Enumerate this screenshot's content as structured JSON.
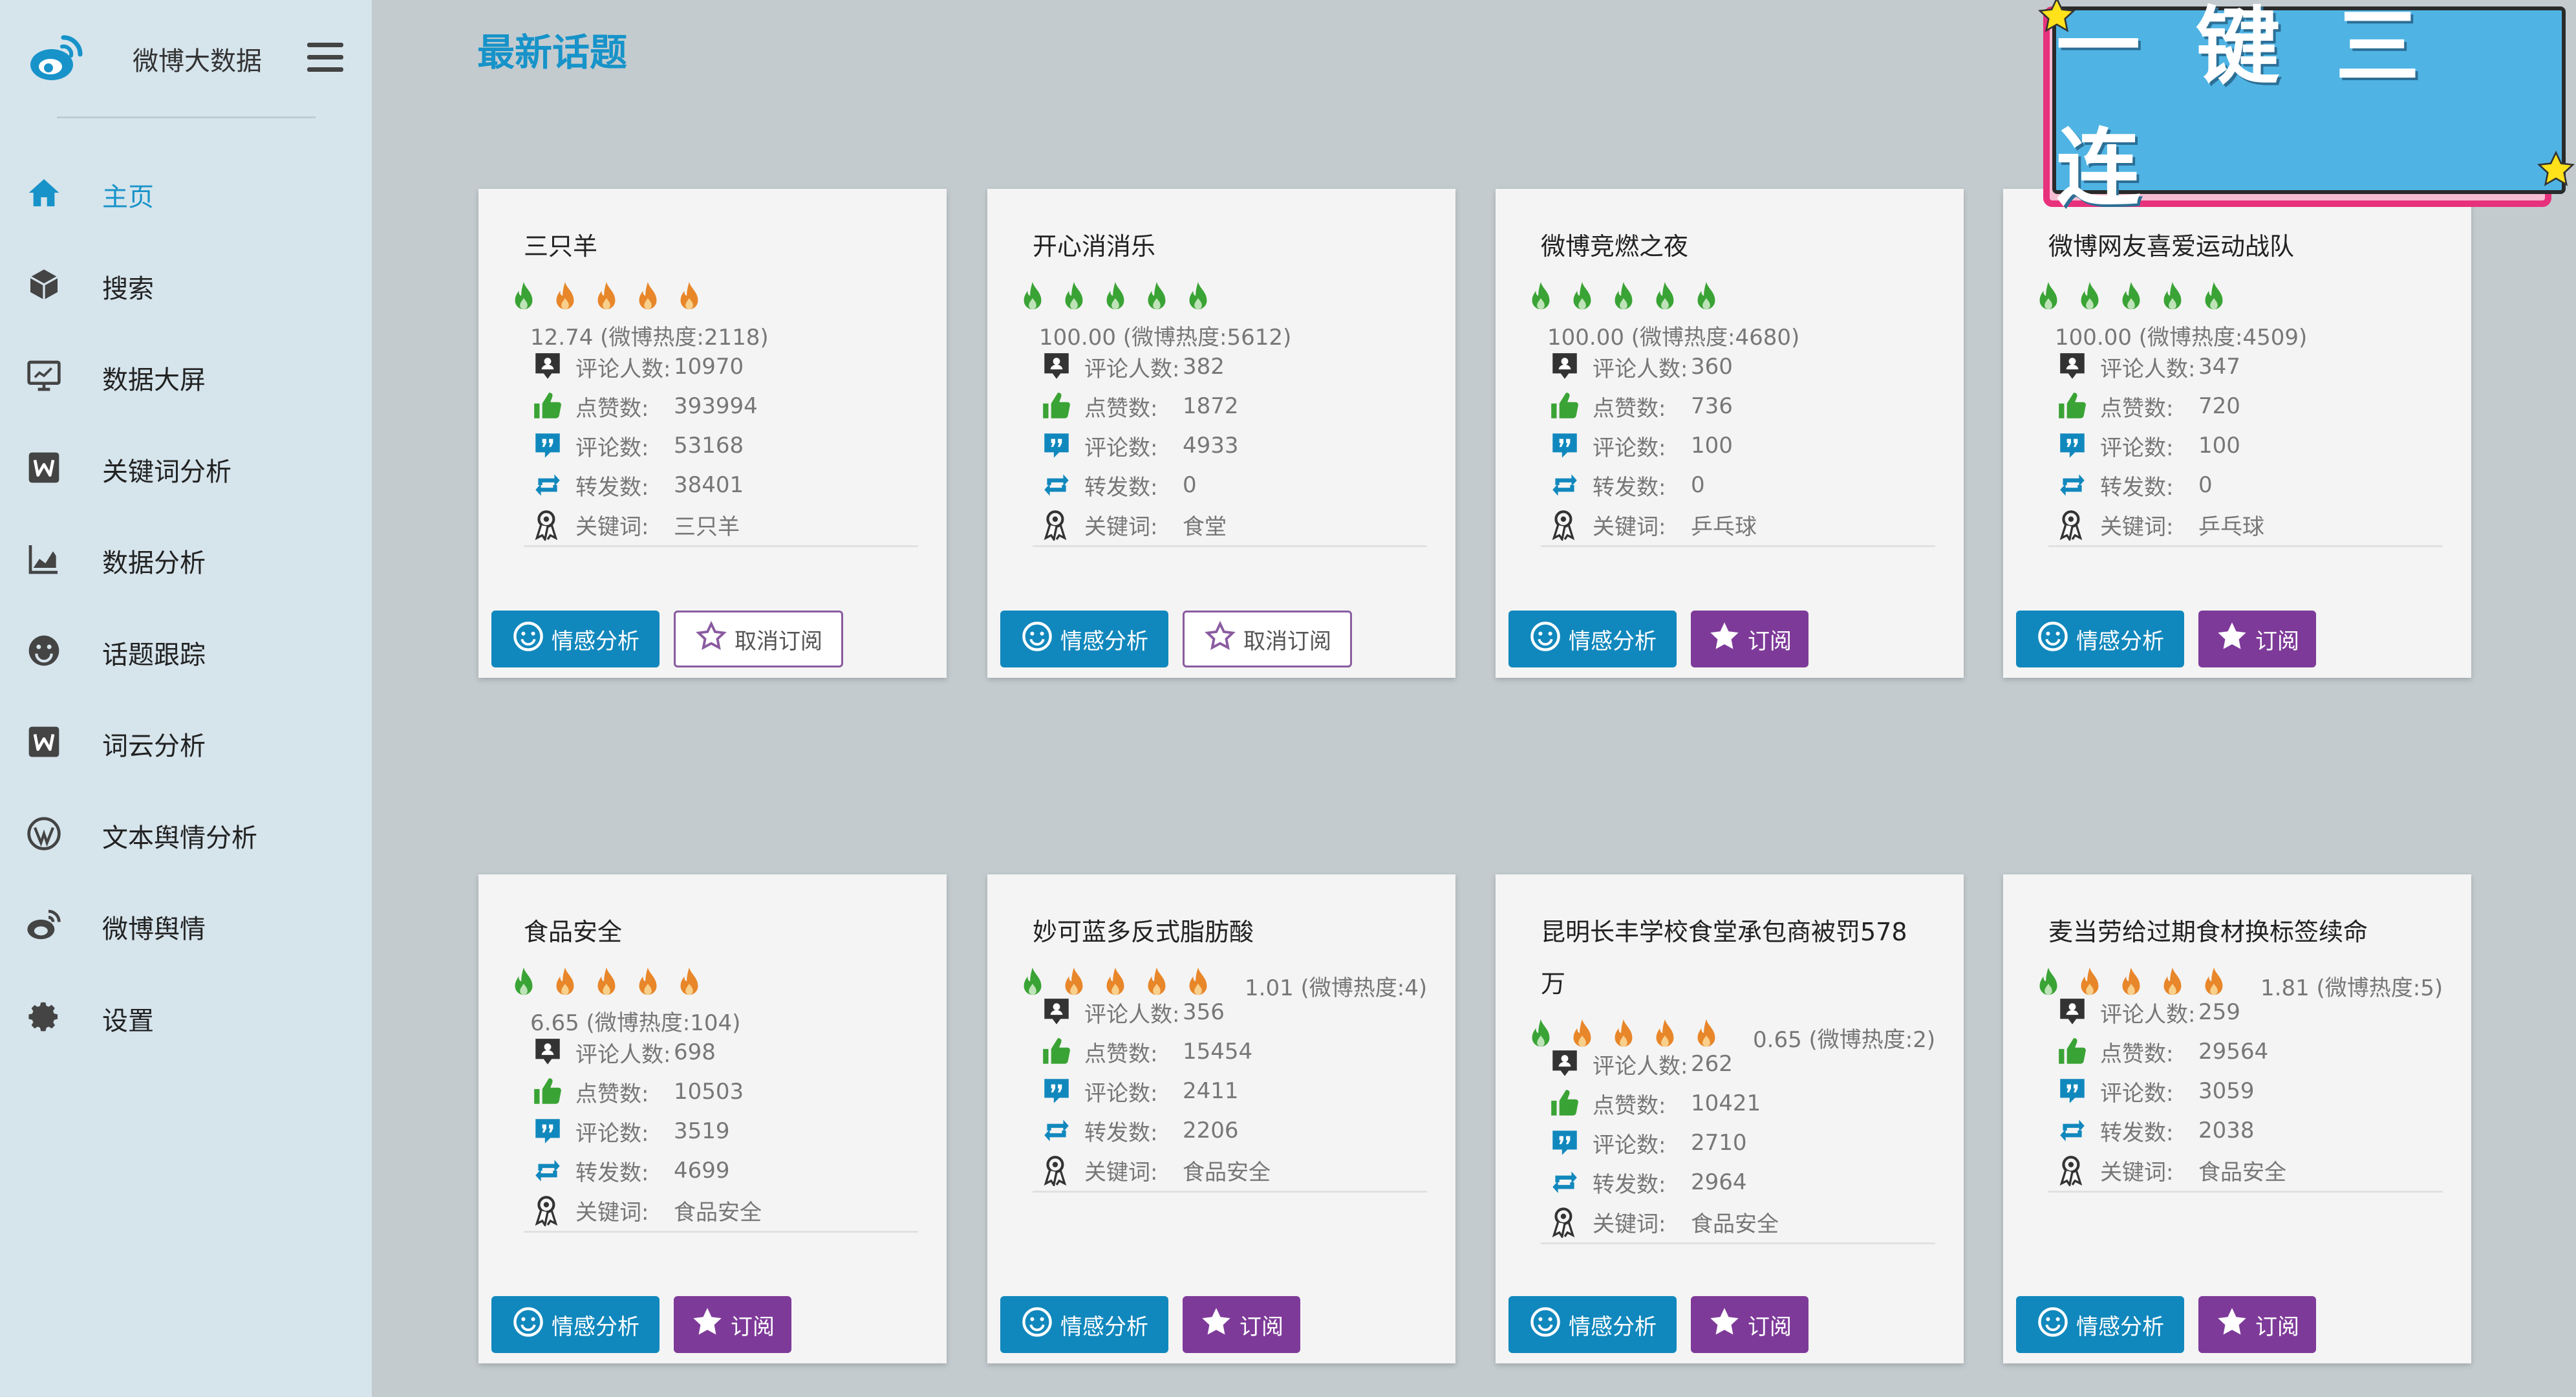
{
  "app": {
    "title": "微博大数据"
  },
  "nav": [
    {
      "label": "主页",
      "icon": "home-icon",
      "active": true
    },
    {
      "label": "搜索",
      "icon": "cube-icon"
    },
    {
      "label": "数据大屏",
      "icon": "monitor-icon"
    },
    {
      "label": "关键词分析",
      "icon": "word-icon"
    },
    {
      "label": "数据分析",
      "icon": "area-chart-icon"
    },
    {
      "label": "话题跟踪",
      "icon": "smile-icon"
    },
    {
      "label": "词云分析",
      "icon": "word-icon"
    },
    {
      "label": "文本舆情分析",
      "icon": "wordpress-icon"
    },
    {
      "label": "微博舆情",
      "icon": "weibo-icon"
    },
    {
      "label": "设置",
      "icon": "gear-icon"
    }
  ],
  "page": {
    "title": "最新话题"
  },
  "labels": {
    "commenters": "评论人数:",
    "likes": "点赞数:",
    "comments": "评论数:",
    "reposts": "转发数:",
    "keyword": "关键词:",
    "emotion_btn": "情感分析",
    "subscribe_btn": "订阅",
    "unsubscribe_btn": "取消订阅"
  },
  "colors": {
    "accent": "#1793c9",
    "button_blue": "#1188bd",
    "button_purple": "#7e3a99",
    "flame_green": "#3aa335",
    "flame_orange": "#e8862a"
  },
  "topics": [
    {
      "title": "三只羊",
      "heat": "12.74 (微博热度:2118)",
      "flame_colors": [
        "g",
        "o",
        "o",
        "o",
        "o"
      ],
      "commenters": "10970",
      "likes": "393994",
      "comments": "53168",
      "reposts": "38401",
      "keyword": "三只羊",
      "subscribed": true
    },
    {
      "title": "开心消消乐",
      "heat": "100.00 (微博热度:5612)",
      "flame_colors": [
        "g",
        "g",
        "g",
        "g",
        "g"
      ],
      "commenters": "382",
      "likes": "1872",
      "comments": "4933",
      "reposts": "0",
      "keyword": "食堂",
      "subscribed": true
    },
    {
      "title": "微博竞燃之夜",
      "heat": "100.00 (微博热度:4680)",
      "flame_colors": [
        "g",
        "g",
        "g",
        "g",
        "g"
      ],
      "commenters": "360",
      "likes": "736",
      "comments": "100",
      "reposts": "0",
      "keyword": "乒乓球",
      "subscribed": false
    },
    {
      "title": "微博网友喜爱运动战队",
      "heat": "100.00 (微博热度:4509)",
      "flame_colors": [
        "g",
        "g",
        "g",
        "g",
        "g"
      ],
      "commenters": "347",
      "likes": "720",
      "comments": "100",
      "reposts": "0",
      "keyword": "乒乓球",
      "subscribed": false
    },
    {
      "title": "食品安全",
      "heat": "6.65 (微博热度:104)",
      "flame_colors": [
        "g",
        "o",
        "o",
        "o",
        "o"
      ],
      "commenters": "698",
      "likes": "10503",
      "comments": "3519",
      "reposts": "4699",
      "keyword": "食品安全",
      "subscribed": false
    },
    {
      "title": "妙可蓝多反式脂肪酸",
      "heat": "1.01 (微博热度:4)",
      "flame_colors": [
        "g",
        "o",
        "o",
        "o",
        "o"
      ],
      "commenters": "356",
      "likes": "15454",
      "comments": "2411",
      "reposts": "2206",
      "keyword": "食品安全",
      "subscribed": false
    },
    {
      "title": "昆明长丰学校食堂承包商被罚578",
      "title_line2": "万",
      "heat": "0.65 (微博热度:2)",
      "flame_colors": [
        "g",
        "o",
        "o",
        "o",
        "o"
      ],
      "commenters": "262",
      "likes": "10421",
      "comments": "2710",
      "reposts": "2964",
      "keyword": "食品安全",
      "subscribed": false
    },
    {
      "title": "麦当劳给过期食材换标签续命",
      "heat": "1.81 (微博热度:5)",
      "flame_colors": [
        "g",
        "o",
        "o",
        "o",
        "o"
      ],
      "commenters": "259",
      "likes": "29564",
      "comments": "3059",
      "reposts": "2038",
      "keyword": "食品安全",
      "subscribed": false
    }
  ],
  "promo": {
    "text": "一键三连"
  }
}
